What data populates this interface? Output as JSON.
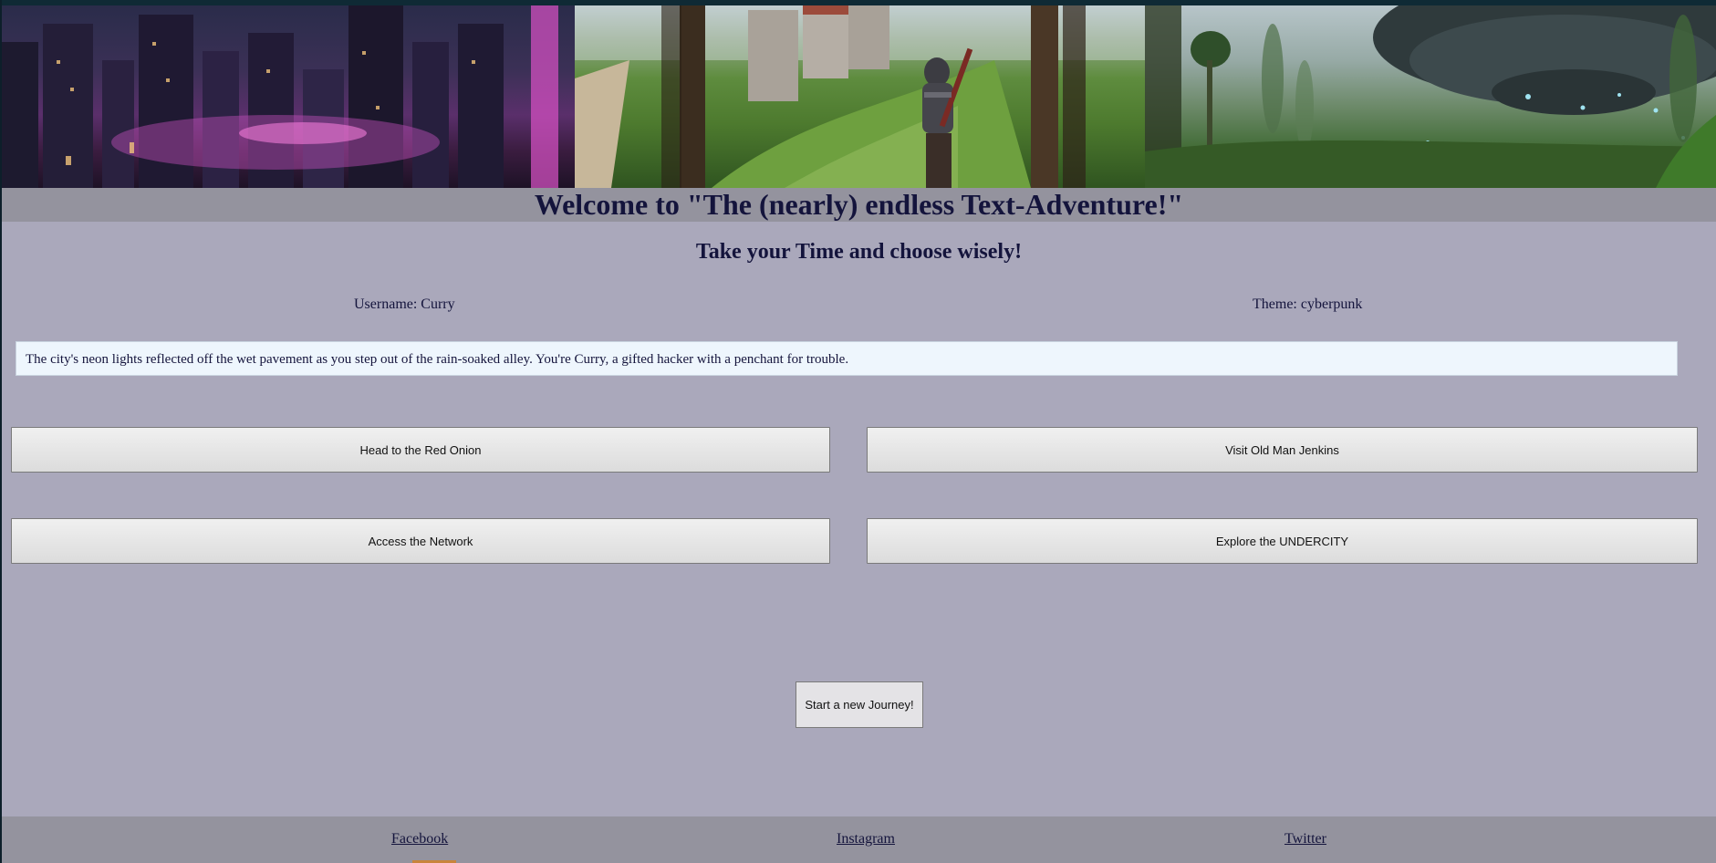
{
  "header": {
    "title": "Welcome to \"The (nearly) endless Text-Adventure!\"",
    "subtitle": "Take your Time and choose wisely!"
  },
  "info": {
    "username": "Username: Curry",
    "theme": "Theme: cyberpunk"
  },
  "story": {
    "text": "The city's neon lights reflected off the wet pavement as you step out of the rain-soaked alley. You're Curry, a gifted hacker with a penchant for trouble."
  },
  "choices": [
    {
      "label": "Head to the Red Onion"
    },
    {
      "label": "Visit Old Man Jenkins"
    },
    {
      "label": "Access the Network"
    },
    {
      "label": "Explore the UNDERCITY"
    }
  ],
  "actions": {
    "new_journey": "Start a new Journey!"
  },
  "footer": {
    "links": [
      {
        "label": "Facebook"
      },
      {
        "label": "Instagram"
      },
      {
        "label": "Twitter"
      }
    ]
  }
}
